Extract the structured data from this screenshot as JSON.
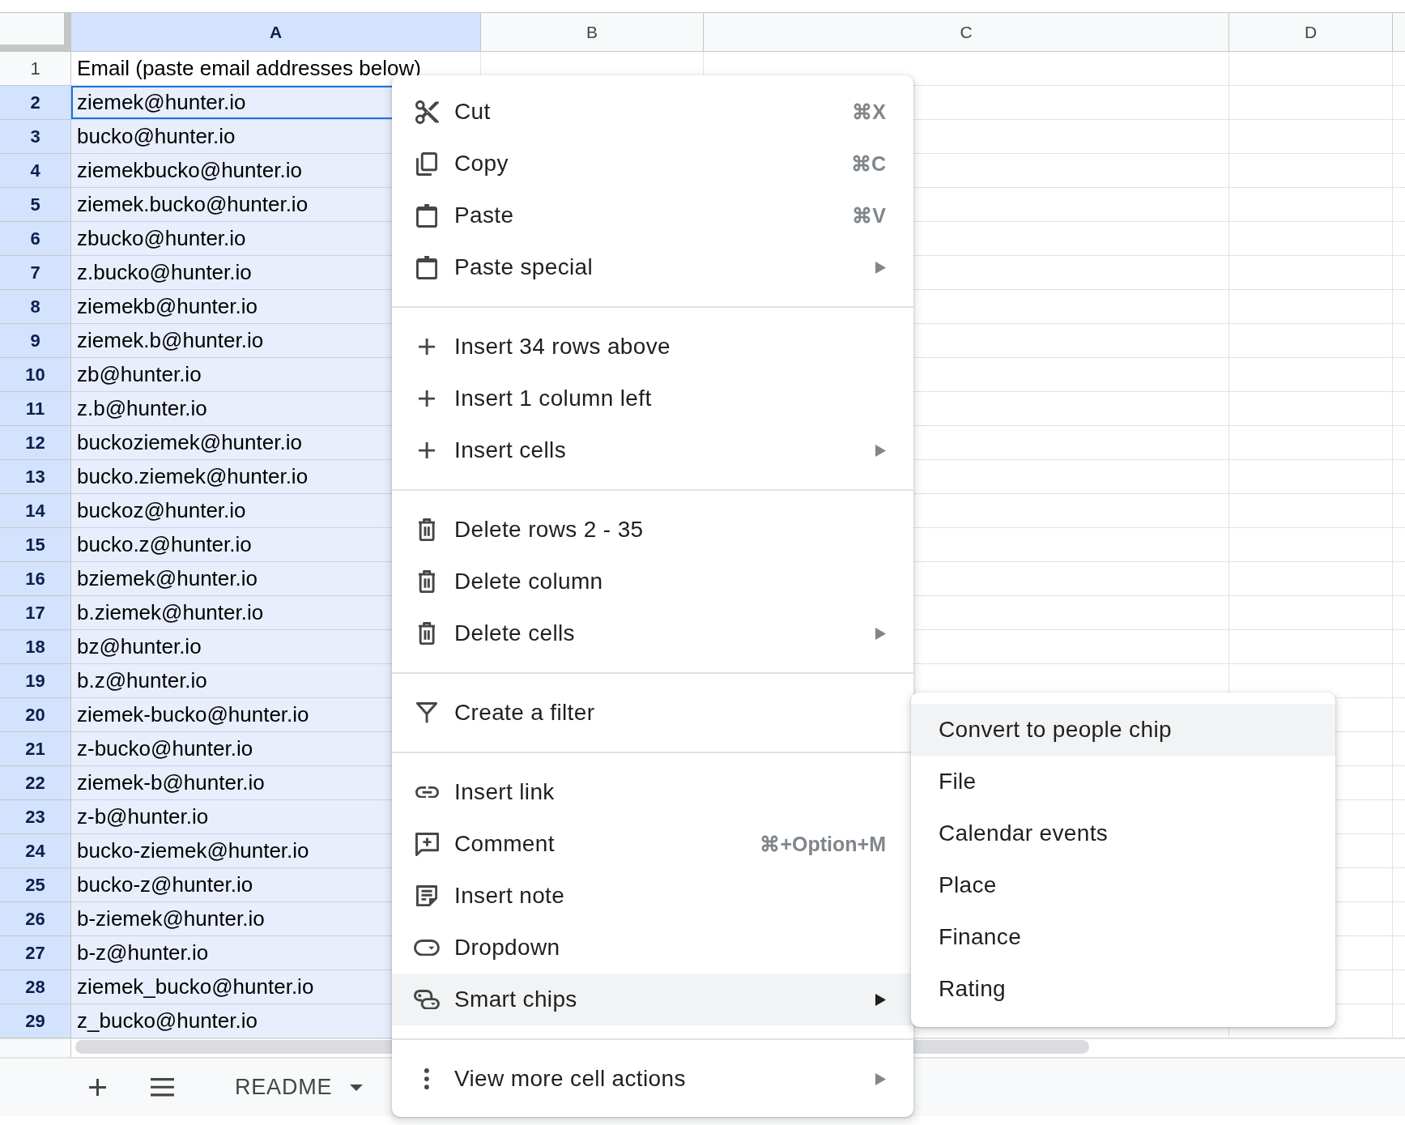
{
  "columns": [
    {
      "label": "A",
      "selected": true
    },
    {
      "label": "B",
      "selected": false
    },
    {
      "label": "C",
      "selected": false
    },
    {
      "label": "D",
      "selected": false
    }
  ],
  "rows": [
    {
      "number": "1",
      "selected": false,
      "active": false,
      "value": "Email (paste email addresses below)"
    },
    {
      "number": "2",
      "selected": true,
      "active": true,
      "value": "ziemek@hunter.io"
    },
    {
      "number": "3",
      "selected": true,
      "active": false,
      "value": "bucko@hunter.io"
    },
    {
      "number": "4",
      "selected": true,
      "active": false,
      "value": "ziemekbucko@hunter.io"
    },
    {
      "number": "5",
      "selected": true,
      "active": false,
      "value": "ziemek.bucko@hunter.io"
    },
    {
      "number": "6",
      "selected": true,
      "active": false,
      "value": "zbucko@hunter.io"
    },
    {
      "number": "7",
      "selected": true,
      "active": false,
      "value": "z.bucko@hunter.io"
    },
    {
      "number": "8",
      "selected": true,
      "active": false,
      "value": "ziemekb@hunter.io"
    },
    {
      "number": "9",
      "selected": true,
      "active": false,
      "value": "ziemek.b@hunter.io"
    },
    {
      "number": "10",
      "selected": true,
      "active": false,
      "value": "zb@hunter.io"
    },
    {
      "number": "11",
      "selected": true,
      "active": false,
      "value": "z.b@hunter.io"
    },
    {
      "number": "12",
      "selected": true,
      "active": false,
      "value": "buckoziemek@hunter.io"
    },
    {
      "number": "13",
      "selected": true,
      "active": false,
      "value": "bucko.ziemek@hunter.io"
    },
    {
      "number": "14",
      "selected": true,
      "active": false,
      "value": "buckoz@hunter.io"
    },
    {
      "number": "15",
      "selected": true,
      "active": false,
      "value": "bucko.z@hunter.io"
    },
    {
      "number": "16",
      "selected": true,
      "active": false,
      "value": "bziemek@hunter.io"
    },
    {
      "number": "17",
      "selected": true,
      "active": false,
      "value": "b.ziemek@hunter.io"
    },
    {
      "number": "18",
      "selected": true,
      "active": false,
      "value": "bz@hunter.io"
    },
    {
      "number": "19",
      "selected": true,
      "active": false,
      "value": "b.z@hunter.io"
    },
    {
      "number": "20",
      "selected": true,
      "active": false,
      "value": "ziemek-bucko@hunter.io"
    },
    {
      "number": "21",
      "selected": true,
      "active": false,
      "value": "z-bucko@hunter.io"
    },
    {
      "number": "22",
      "selected": true,
      "active": false,
      "value": "ziemek-b@hunter.io"
    },
    {
      "number": "23",
      "selected": true,
      "active": false,
      "value": "z-b@hunter.io"
    },
    {
      "number": "24",
      "selected": true,
      "active": false,
      "value": "bucko-ziemek@hunter.io"
    },
    {
      "number": "25",
      "selected": true,
      "active": false,
      "value": "bucko-z@hunter.io"
    },
    {
      "number": "26",
      "selected": true,
      "active": false,
      "value": "b-ziemek@hunter.io"
    },
    {
      "number": "27",
      "selected": true,
      "active": false,
      "value": "b-z@hunter.io"
    },
    {
      "number": "28",
      "selected": true,
      "active": false,
      "value": "ziemek_bucko@hunter.io"
    },
    {
      "number": "29",
      "selected": true,
      "active": false,
      "value": "z_bucko@hunter.io"
    }
  ],
  "context_menu": {
    "sections": [
      {
        "items": [
          {
            "label": "Cut",
            "shortcut": "⌘X",
            "has_submenu": false,
            "selected": false
          },
          {
            "label": "Copy",
            "shortcut": "⌘C",
            "has_submenu": false,
            "selected": false
          },
          {
            "label": "Paste",
            "shortcut": "⌘V",
            "has_submenu": false,
            "selected": false
          },
          {
            "label": "Paste special",
            "has_submenu": true,
            "selected": false
          }
        ]
      },
      {
        "items": [
          {
            "label": "Insert 34 rows above",
            "has_submenu": false,
            "selected": false
          },
          {
            "label": "Insert 1 column left",
            "has_submenu": false,
            "selected": false
          },
          {
            "label": "Insert cells",
            "has_submenu": true,
            "selected": false
          }
        ]
      },
      {
        "items": [
          {
            "label": "Delete rows 2 - 35",
            "has_submenu": false,
            "selected": false
          },
          {
            "label": "Delete column",
            "has_submenu": false,
            "selected": false
          },
          {
            "label": "Delete cells",
            "has_submenu": true,
            "selected": false
          }
        ]
      },
      {
        "items": [
          {
            "label": "Create a filter",
            "has_submenu": false,
            "selected": false
          }
        ]
      },
      {
        "items": [
          {
            "label": "Insert link",
            "has_submenu": false,
            "selected": false
          },
          {
            "label": "Comment",
            "shortcut": "⌘+Option+M",
            "has_submenu": false,
            "selected": false
          },
          {
            "label": "Insert note",
            "has_submenu": false,
            "selected": false
          },
          {
            "label": "Dropdown",
            "has_submenu": false,
            "selected": false
          },
          {
            "label": "Smart chips",
            "has_submenu": true,
            "selected": true
          }
        ]
      },
      {
        "items": [
          {
            "label": "View more cell actions",
            "has_submenu": true,
            "selected": false
          }
        ]
      }
    ]
  },
  "submenu": {
    "items": [
      {
        "label": "Convert to people chip",
        "selected": true
      },
      {
        "label": "File",
        "selected": false
      },
      {
        "label": "Calendar events",
        "selected": false
      },
      {
        "label": "Place",
        "selected": false
      },
      {
        "label": "Finance",
        "selected": false
      },
      {
        "label": "Rating",
        "selected": false
      }
    ]
  },
  "sheet_bar": {
    "tabs": [
      {
        "label": "README"
      }
    ]
  }
}
